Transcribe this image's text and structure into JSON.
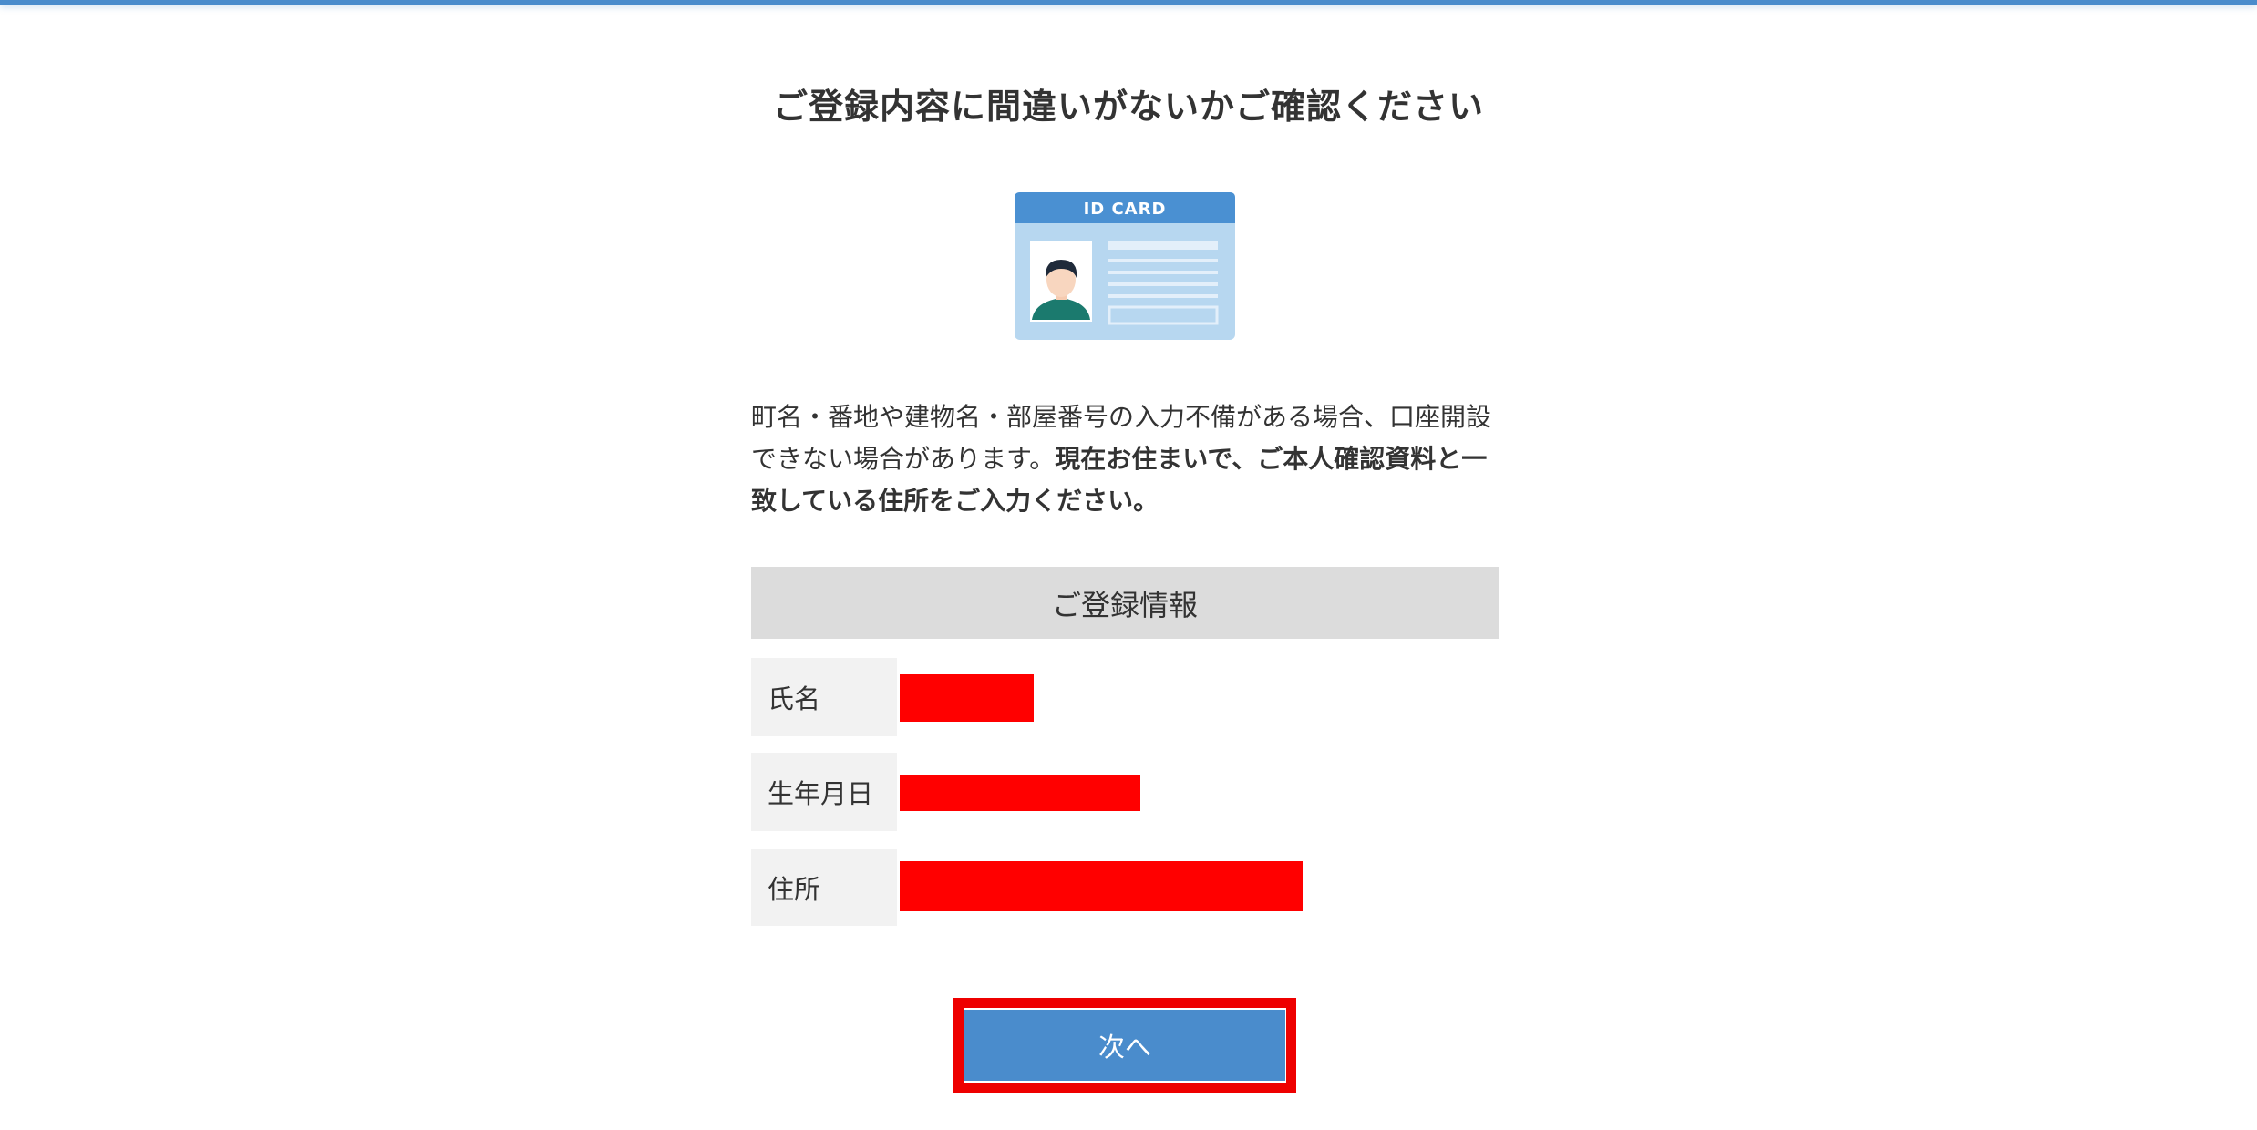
{
  "page": {
    "title": "ご登録内容に間違いがないかご確認ください"
  },
  "id_card": {
    "label": "ID CARD",
    "header_color": "#4a90d2",
    "body_color": "#b7d7f0"
  },
  "notice": {
    "normal_text": "町名・番地や建物名・部屋番号の入力不備がある場合、口座開設できない場合があります。",
    "bold_text": "現在お住まいで、ご本人確認資料と一致している住所をご入力ください。"
  },
  "registration": {
    "header": "ご登録情報",
    "rows": [
      {
        "label": "氏名",
        "value_redacted": true
      },
      {
        "label": "生年月日",
        "value_redacted": true
      },
      {
        "label": "住所",
        "value_redacted": true
      }
    ]
  },
  "next_button": {
    "label": "次へ",
    "color": "#4a8ccc",
    "highlight_color": "#ee0000"
  }
}
